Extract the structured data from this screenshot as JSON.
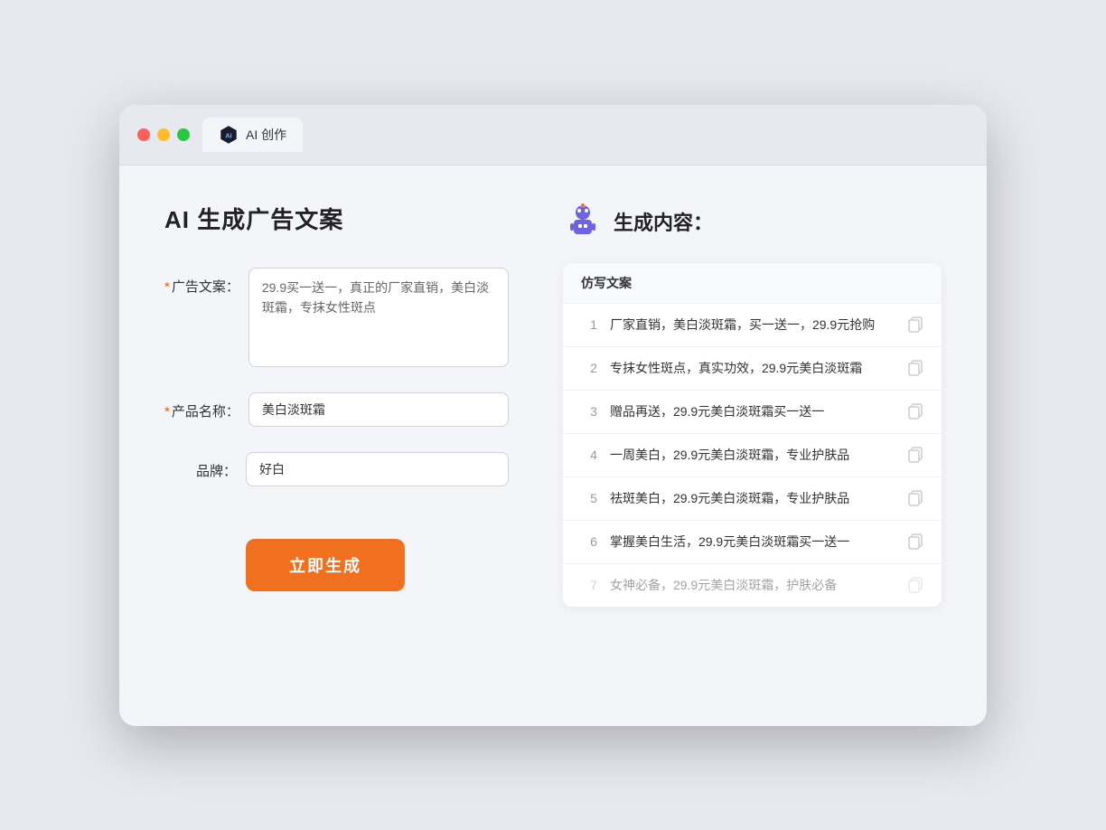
{
  "browser": {
    "tab_label": "AI 创作"
  },
  "left": {
    "page_title": "AI 生成广告文案",
    "form": {
      "ad_copy_label": "广告文案：",
      "ad_copy_required": true,
      "ad_copy_value": "29.9买一送一，真正的厂家直销，美白淡斑霜，专抹女性斑点",
      "product_name_label": "产品名称：",
      "product_name_required": true,
      "product_name_value": "美白淡斑霜",
      "brand_label": "品牌：",
      "brand_required": false,
      "brand_value": "好白"
    },
    "generate_button": "立即生成"
  },
  "right": {
    "section_title": "生成内容：",
    "table_header": "仿写文案",
    "results": [
      {
        "num": "1",
        "text": "厂家直销，美白淡斑霜，买一送一，29.9元抢购",
        "faded": false
      },
      {
        "num": "2",
        "text": "专抹女性斑点，真实功效，29.9元美白淡斑霜",
        "faded": false
      },
      {
        "num": "3",
        "text": "赠品再送，29.9元美白淡斑霜买一送一",
        "faded": false
      },
      {
        "num": "4",
        "text": "一周美白，29.9元美白淡斑霜，专业护肤品",
        "faded": false
      },
      {
        "num": "5",
        "text": "祛斑美白，29.9元美白淡斑霜，专业护肤品",
        "faded": false
      },
      {
        "num": "6",
        "text": "掌握美白生活，29.9元美白淡斑霜买一送一",
        "faded": false
      },
      {
        "num": "7",
        "text": "女神必备，29.9元美白淡斑霜，护肤必备",
        "faded": true
      }
    ]
  }
}
